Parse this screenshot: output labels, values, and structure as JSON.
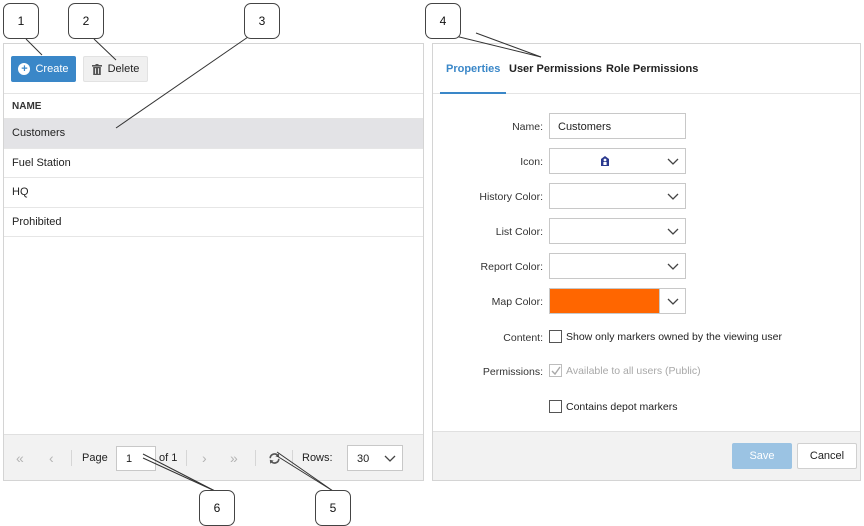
{
  "callouts": [
    "1",
    "2",
    "3",
    "4",
    "5",
    "6"
  ],
  "toolbar": {
    "create_label": "Create",
    "delete_label": "Delete"
  },
  "grid": {
    "column_header": "NAME",
    "rows": [
      "Customers",
      "Fuel Station",
      "HQ",
      "Prohibited"
    ],
    "selected_row": "Customers"
  },
  "pager": {
    "page_label": "Page",
    "current_page": "1",
    "of_label": "of 1",
    "rows_label": "Rows:",
    "rows_value": "30"
  },
  "tabs": [
    "Properties",
    "User Permissions",
    "Role Permissions"
  ],
  "active_tab": "Properties",
  "form": {
    "name_label": "Name:",
    "name_value": "Customers",
    "icon_label": "Icon:",
    "icon_name": "person-marker-icon",
    "history_color_label": "History Color:",
    "list_color_label": "List Color:",
    "report_color_label": "Report Color:",
    "map_color_label": "Map Color:",
    "map_color_value": "#ff6600",
    "content_label": "Content:",
    "content_checkbox_text": "Show only markers owned by the viewing user",
    "permissions_label": "Permissions:",
    "permissions_checkbox_text": "Available to all users (Public)",
    "depot_checkbox_text": "Contains depot markers"
  },
  "footer": {
    "save_label": "Save",
    "cancel_label": "Cancel"
  },
  "colors": {
    "accent": "#3a87c8",
    "selected_row": "#e3e3e6",
    "map_color": "#ff6600"
  }
}
